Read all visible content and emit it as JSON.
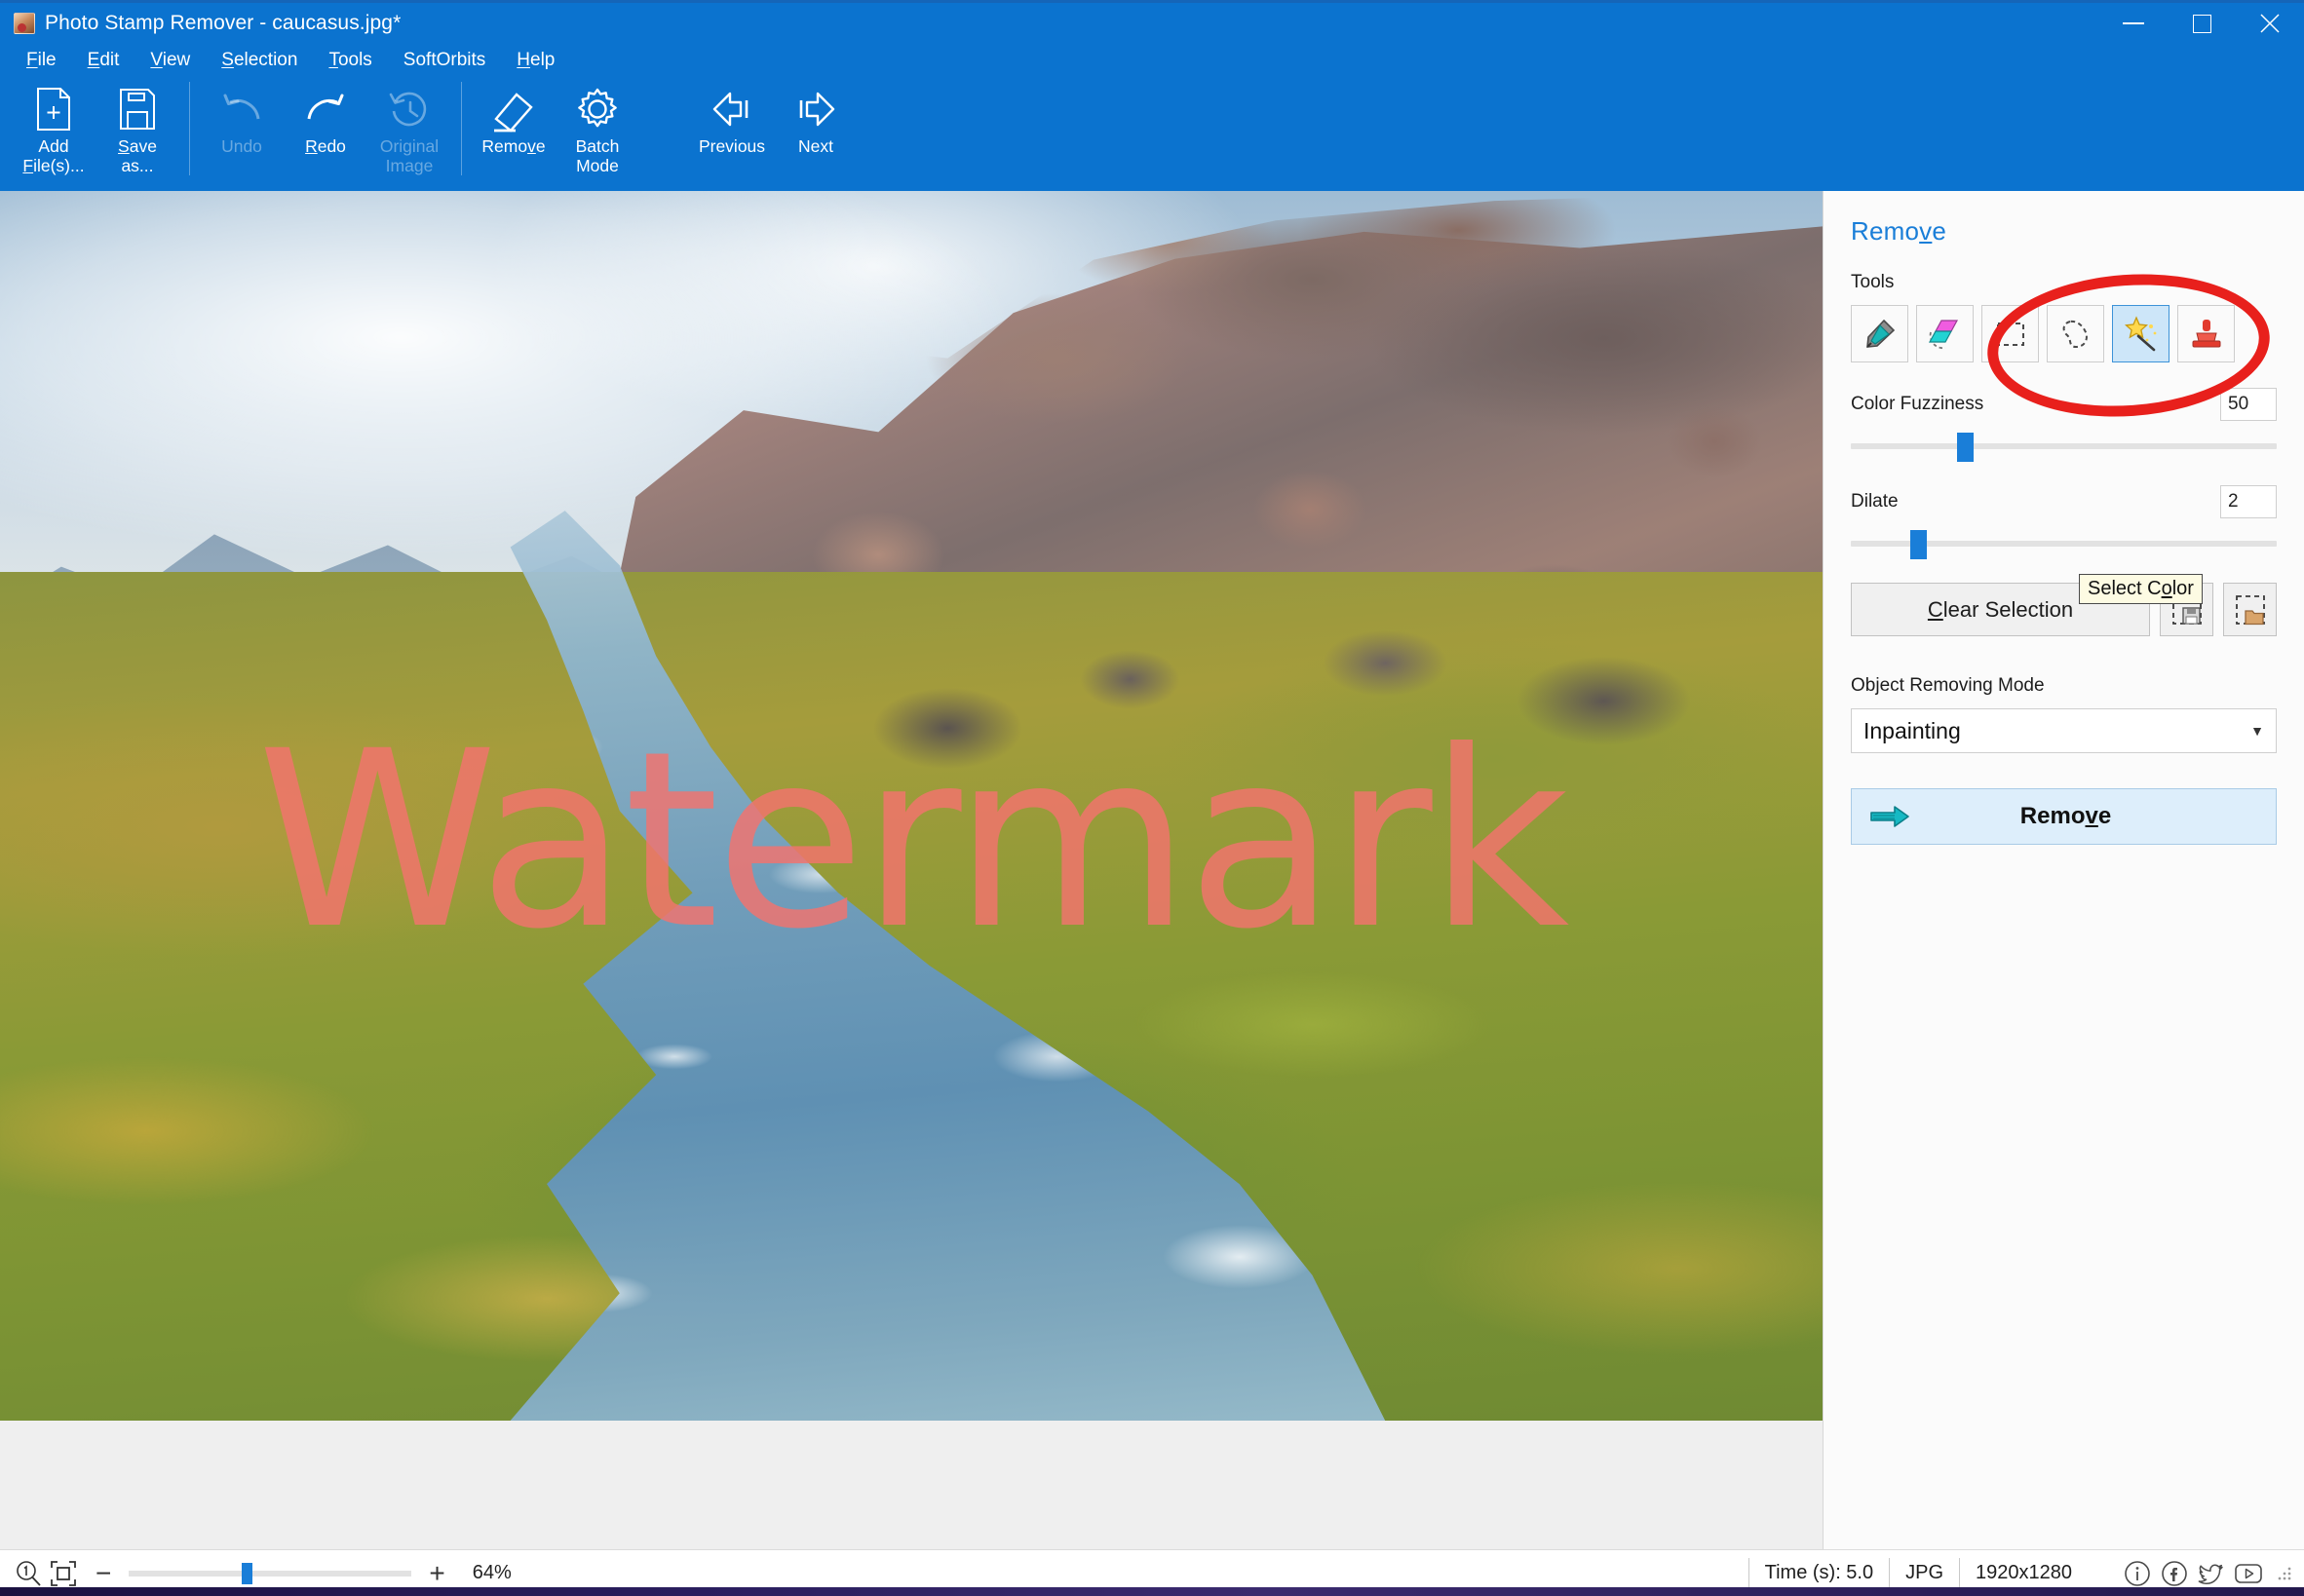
{
  "window": {
    "title": "Photo Stamp Remover - caucasus.jpg*",
    "app_icon": "photo-stamp-remover-icon",
    "minimize": "minimize-icon",
    "maximize": "maximize-icon",
    "close": "close-icon",
    "accent_color": "#0b73cf"
  },
  "menu": {
    "items": [
      {
        "label": "File",
        "accel": "F"
      },
      {
        "label": "Edit",
        "accel": "E"
      },
      {
        "label": "View",
        "accel": "V"
      },
      {
        "label": "Selection",
        "accel": "S"
      },
      {
        "label": "Tools",
        "accel": "T"
      },
      {
        "label": "SoftOrbits",
        "accel": ""
      },
      {
        "label": "Help",
        "accel": "H"
      }
    ]
  },
  "toolbar": {
    "buttons": [
      {
        "id": "add-files",
        "line1": "Add",
        "line2": "File(s)...",
        "icon": "add-file-icon",
        "enabled": true
      },
      {
        "id": "save-as",
        "line1": "Save",
        "line2": "as...",
        "icon": "save-icon",
        "enabled": true
      },
      {
        "id": "undo",
        "line1": "Undo",
        "line2": "",
        "icon": "undo-icon",
        "enabled": false
      },
      {
        "id": "redo",
        "line1": "Redo",
        "line2": "",
        "icon": "redo-icon",
        "enabled": true
      },
      {
        "id": "original-image",
        "line1": "Original",
        "line2": "Image",
        "icon": "history-clock-icon",
        "enabled": false
      },
      {
        "id": "remove",
        "line1": "Remove",
        "line2": "",
        "icon": "eraser-icon",
        "enabled": true
      },
      {
        "id": "batch-mode",
        "line1": "Batch",
        "line2": "Mode",
        "icon": "gear-icon",
        "enabled": true
      },
      {
        "id": "previous",
        "line1": "Previous",
        "line2": "",
        "icon": "arrow-left-bar-icon",
        "enabled": true
      },
      {
        "id": "next",
        "line1": "Next",
        "line2": "",
        "icon": "arrow-right-bar-icon",
        "enabled": true
      }
    ]
  },
  "canvas": {
    "image_name": "caucasus.jpg",
    "watermark_text": "Watermark",
    "watermark_color": "#f4736e",
    "background_color": "#efefef"
  },
  "panel": {
    "title": "Remove",
    "title_accel": "v",
    "tools_label": "Tools",
    "tools": [
      {
        "id": "marker",
        "name": "marker-pen-icon",
        "selected": false
      },
      {
        "id": "eraser",
        "name": "eraser-tool-icon",
        "selected": false
      },
      {
        "id": "rectangle-select",
        "name": "rectangle-select-icon",
        "selected": false
      },
      {
        "id": "lasso-select",
        "name": "lasso-select-icon",
        "selected": false
      },
      {
        "id": "magic-wand",
        "name": "magic-wand-icon",
        "selected": true
      },
      {
        "id": "stamp",
        "name": "stamp-icon",
        "selected": false
      }
    ],
    "color_fuzziness": {
      "label": "Color Fuzziness",
      "value": "50",
      "slider_percent": 26
    },
    "dilate": {
      "label": "Dilate",
      "value": "2",
      "slider_percent": 20
    },
    "clear_selection": "Clear Selection",
    "clear_selection_accel": "C",
    "save_selection_icon": "save-selection-icon",
    "load_selection_icon": "load-selection-icon",
    "mode_label": "Object Removing Mode",
    "mode_value": "Inpainting",
    "remove_button": "Remove",
    "remove_button_accel": "v",
    "tooltip": "Select Color",
    "tooltip_accel": "o",
    "annotation_color": "#e8201c"
  },
  "statusbar": {
    "zoom_one_to_one_icon": "zoom-actual-size-icon",
    "fit_to_window_icon": "fit-to-window-icon",
    "zoom_out": "−",
    "zoom_in": "+",
    "zoom_value": "64%",
    "zoom_slider_percent": 40,
    "time": "Time (s): 5.0",
    "format": "JPG",
    "dimensions": "1920x1280",
    "social": [
      {
        "id": "info",
        "name": "info-icon"
      },
      {
        "id": "facebook",
        "name": "facebook-icon"
      },
      {
        "id": "twitter",
        "name": "twitter-icon"
      },
      {
        "id": "youtube",
        "name": "youtube-icon"
      }
    ]
  }
}
